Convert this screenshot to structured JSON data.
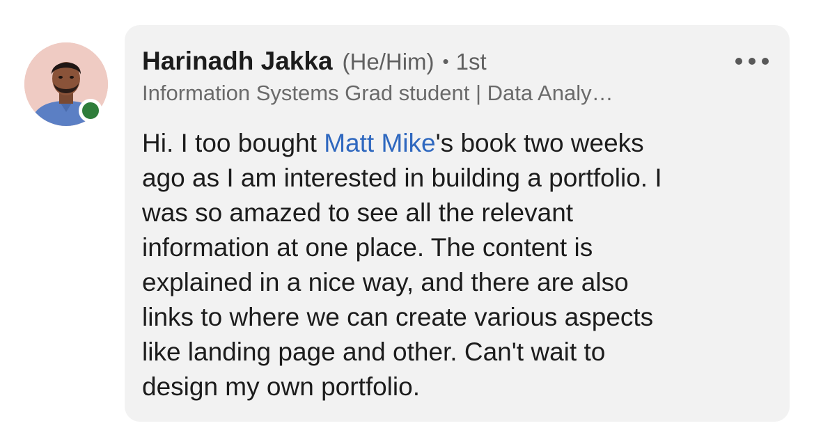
{
  "comment": {
    "author": {
      "name": "Harinadh Jakka",
      "pronouns": "(He/Him)",
      "separator": "•",
      "degree": "1st",
      "headline": "Information Systems Grad student | Data Analy…",
      "presence": "online"
    },
    "more_icon": "more-horizontal-icon",
    "body_lines": [
      {
        "before": "Hi. I too bought ",
        "mention": "Matt Mike",
        "after": "'s book two weeks"
      },
      {
        "text": "ago as I am interested in building a portfolio. I"
      },
      {
        "text": "was so amazed to see all the relevant"
      },
      {
        "text": "information at one place. The content is"
      },
      {
        "text": "explained in a nice way, and there are also"
      },
      {
        "text": "links to where we can create various aspects"
      },
      {
        "text": "like landing page and other. Can't wait to"
      },
      {
        "text": "design my own portfolio."
      }
    ]
  },
  "colors": {
    "bubble_background": "#f2f2f2",
    "mention_link": "#2f68bf",
    "presence_online": "#2f7d3b",
    "secondary_text": "#606060"
  }
}
